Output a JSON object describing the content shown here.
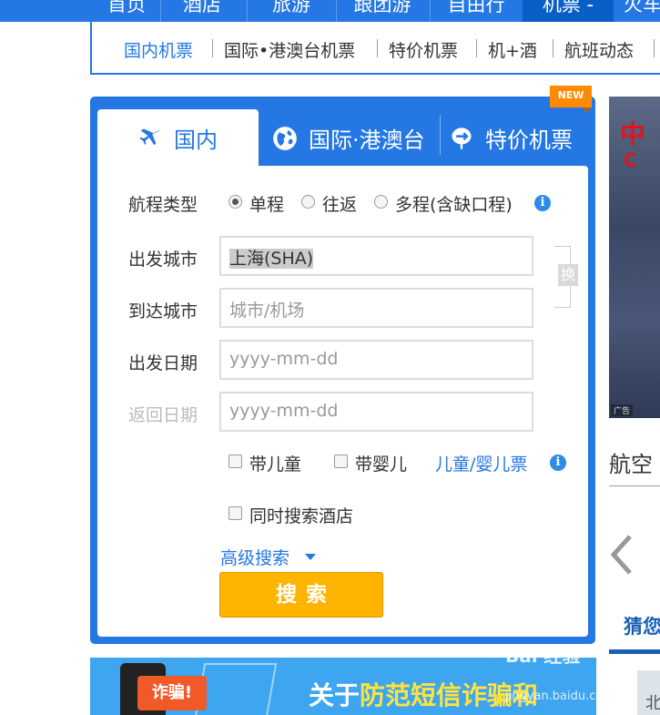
{
  "topnav": {
    "items": [
      {
        "label": "首页"
      },
      {
        "label": "酒店"
      },
      {
        "label": "旅游"
      },
      {
        "label": "跟团游"
      },
      {
        "label": "自由行"
      },
      {
        "label": "机票 -"
      },
      {
        "label": "火车"
      }
    ]
  },
  "subnav": {
    "items": [
      {
        "label": "国内机票"
      },
      {
        "label": "国际•港澳台机票"
      },
      {
        "label": "特价机票"
      },
      {
        "label": "机+酒"
      },
      {
        "label": "航班动态"
      }
    ]
  },
  "tabs": [
    {
      "label": "国内",
      "icon": "plane-icon"
    },
    {
      "label": "国际·港澳台",
      "icon": "globe-icon"
    },
    {
      "label": "特价机票",
      "icon": "discount-icon"
    }
  ],
  "new_badge": "NEW",
  "form": {
    "trip_type_label": "航程类型",
    "trip_options": [
      "单程",
      "往返",
      "多程(含缺口程)"
    ],
    "selected_trip": "单程",
    "depart_city_label": "出发城市",
    "depart_city_value": "上海(SHA)",
    "arrive_city_label": "到达城市",
    "arrive_city_placeholder": "城市/机场",
    "depart_date_label": "出发日期",
    "depart_date_placeholder": "yyyy-mm-dd",
    "return_date_label": "返回日期",
    "return_date_placeholder": "yyyy-mm-dd",
    "swap_label": "换",
    "child_label": "带儿童",
    "infant_label": "带婴儿",
    "child_ticket_link": "儿童/婴儿票",
    "hotel_label": "同时搜索酒店",
    "advanced_search": "高级搜索",
    "search_button": "搜索"
  },
  "side": {
    "ad_logo": "中",
    "ad_logo2": "C",
    "ad_tag": "广告",
    "section_title": "航空",
    "guess_tab": "猜您"
  },
  "banner": {
    "warning": "诈骗!",
    "slogan_white1": "关于",
    "slogan_yellow": "防范短信诈骗和",
    "watermark_top": "Bai 经验",
    "watermark_bottom": "jingyan.baidu.com",
    "right_grey": "北"
  },
  "colors": {
    "primary": "#2577e3",
    "search_button": "#ffb400",
    "new_badge": "#ff8a00",
    "banner": "#3ea6f0"
  }
}
